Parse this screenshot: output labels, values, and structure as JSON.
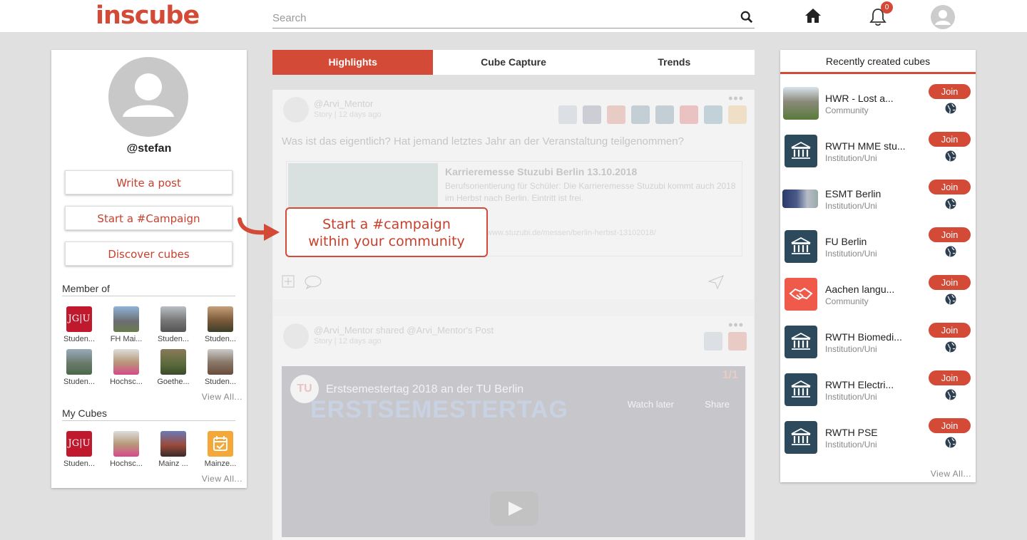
{
  "header": {
    "logo": "inscube",
    "search_placeholder": "Search",
    "notification_count": "0"
  },
  "profile": {
    "username": "@stefan",
    "buttons": [
      "Write a post",
      "Start a #Campaign",
      "Discover cubes"
    ]
  },
  "member_of": {
    "title": "Member of",
    "items": [
      "Studen...",
      "FH Mai...",
      "Studen...",
      "Studen...",
      "Studen...",
      "Hochsc...",
      "Goethe...",
      "Studen..."
    ],
    "view_all": "View All..."
  },
  "my_cubes": {
    "title": "My Cubes",
    "items": [
      "Studen...",
      "Hochsc...",
      "Mainz ...",
      "Mainze..."
    ],
    "view_all": "View All..."
  },
  "tabs": [
    "Highlights",
    "Cube Capture",
    "Trends"
  ],
  "feed": {
    "post1": {
      "author": "@Arvi_Mentor",
      "meta": "Story  |  12 days ago",
      "text": "Was ist das eigentlich? Hat jemand letztes Jahr an der Veranstaltung teilgenommen?",
      "link_title": "Karrieremesse Stuzubi Berlin 13.10.2018",
      "link_desc": "Berufsorientierung für Schüler: Die Karrieremesse Stuzubi kommt auch 2018 im Herbst nach Berlin. Eintritt ist frei.",
      "link_url": "www.stuzubi.de/messen/berlin-herbst-13102018/"
    },
    "post2": {
      "author": "@Arvi_Mentor shared @Arvi_Mentor's Post",
      "meta": "Story  |  12 days ago",
      "video_title": "Erstsemestertag 2018 an der TU Berlin",
      "video_banner": "ERSTSEMESTERTAG",
      "watch_later": "Watch later",
      "share": "Share",
      "page_counter": "1/1"
    }
  },
  "callout": {
    "line1": "Start a #campaign",
    "line2": "within your community"
  },
  "recent": {
    "title": "Recently created cubes",
    "join_label": "Join",
    "items": [
      {
        "name": "HWR - Lost a...",
        "type": "Community"
      },
      {
        "name": "RWTH MME stu...",
        "type": "Institution/Uni"
      },
      {
        "name": "ESMT Berlin",
        "type": "Institution/Uni"
      },
      {
        "name": "FU Berlin",
        "type": "Institution/Uni"
      },
      {
        "name": "Aachen langu...",
        "type": "Community"
      },
      {
        "name": "RWTH Biomedi...",
        "type": "Institution/Uni"
      },
      {
        "name": "RWTH Electri...",
        "type": "Institution/Uni"
      },
      {
        "name": "RWTH PSE",
        "type": "Institution/Uni"
      }
    ],
    "view_all": "View All..."
  },
  "colors": {
    "brand": "#d34a37",
    "institution_tile": "#2c4a5c"
  }
}
